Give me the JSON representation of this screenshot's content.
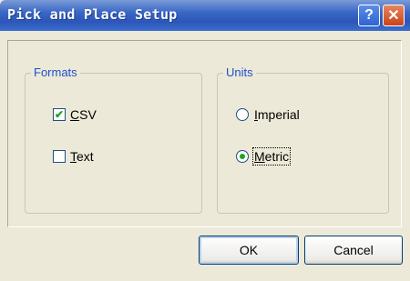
{
  "window": {
    "title": "Pick and Place Setup",
    "help_glyph": "?",
    "close_glyph": "✕"
  },
  "formats": {
    "legend": "Formats",
    "options": [
      {
        "label": "CSV",
        "checked": true
      },
      {
        "label": "Text",
        "checked": false
      }
    ]
  },
  "units": {
    "legend": "Units",
    "options": [
      {
        "label": "Imperial",
        "selected": false
      },
      {
        "label": "Metric",
        "selected": true
      }
    ]
  },
  "buttons": {
    "ok": "OK",
    "cancel": "Cancel"
  },
  "colors": {
    "titlebar": "#2c56b8",
    "dialog_bg": "#ECE9D8",
    "legend_text": "#1f4fcf",
    "check_accent": "#21a121"
  }
}
